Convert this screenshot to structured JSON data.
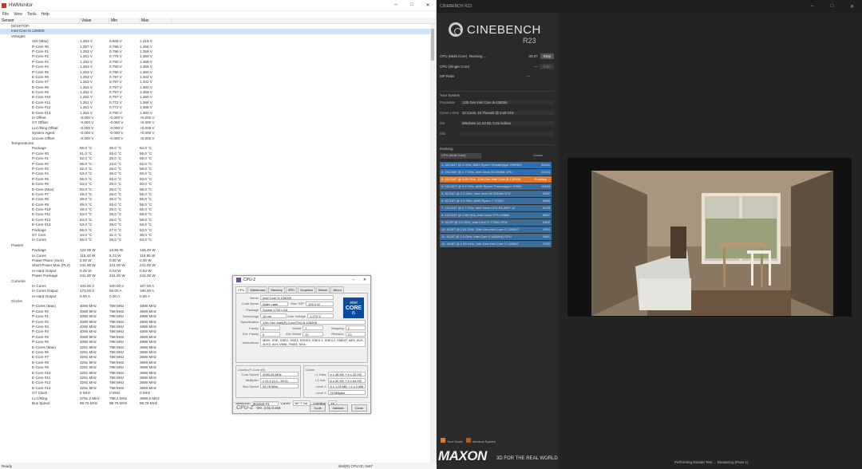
{
  "hwmonitor": {
    "title": "HWMonitor",
    "controls": [
      "–",
      "□",
      "✕"
    ],
    "menu": [
      "File",
      "View",
      "Tools",
      "Help"
    ],
    "columns": [
      "Sensor",
      "Value",
      "Min",
      "Max"
    ],
    "status_left": "Ready",
    "status_right": "Intel(R) CPU ID: 0x97"
  },
  "cpuz": {
    "title": "CPU-Z",
    "tabs": [
      "CPU",
      "Mainboard",
      "Memory",
      "SPD",
      "Graphics",
      "Bench",
      "About"
    ],
    "name": "Intel Core i5 12600K",
    "codename": "Alder Lake",
    "max_tdp": "125.0 W",
    "package": "Socket 1700 LGA",
    "technology": "10 nm",
    "core_voltage": "1.270 V",
    "specification": "12th Gen Intel(R) Core(TM) i5-12600K",
    "family": "6",
    "model": "7",
    "stepping": "2",
    "ext_family": "6",
    "ext_model": "97",
    "revision": "C0",
    "instructions": "MMX, SSE, SSE2, SSE3, SSSE3, SSE4.1, SSE4.2, EM64T, AES, AVX, AVX2, AVX-VNNI, FMA3, SHA",
    "core_speed": "4090.28 MHz",
    "multiplier": "x 41.0 (4.0 - 53.0)",
    "bus_speed": "99.76 MHz",
    "l1_data": "6 x 48 KB + 4 x 32 KB",
    "l1_inst": "6 x 32 KB + 4 x 64 KB",
    "level2": "6 x 1.25 MB + 2 x 2 MB",
    "level3": "20 MBytes",
    "selection": "Socket #1",
    "cores": "6P + 4E",
    "threads": "16",
    "version": "Ver. 2.01.0.x64",
    "buttons": [
      "Tools",
      "Validate",
      "Close"
    ],
    "intel_brand": "intel",
    "intel_core": "CORE",
    "intel_tier": "i5",
    "clocks_label": "Clocks (P-Core #0)",
    "cache_label": "Cache"
  },
  "cinebench": {
    "title": "CINEBENCH R23",
    "brand": "CINEBENCH",
    "version": "R23",
    "controls": [
      "–",
      "□",
      "✕"
    ],
    "multi_label": "CPU (Multi Core)",
    "multi_status": "Running ...",
    "multi_time": "00:37",
    "stop": "Stop",
    "single_label": "CPU (Single Core)",
    "single_time": "---",
    "single_btn": "Start",
    "mp_label": "MP Ratio",
    "mp_val": "---",
    "system_header": "Your System",
    "processor_key": "Processor",
    "processor_val": "12th Gen Intel Core i5-12600K",
    "cores_key": "Cores x GHz",
    "cores_val": "10 Cores, 16 Threads @ 3.69 GHz",
    "os_key": "OS",
    "os_val": "Windows 10, 64 Bit, Core Edition",
    "info_key": "Info",
    "info_val": "",
    "ranking_header": "Ranking",
    "ranking_select": "CPU (Multi Core)",
    "ranking_details": "Details",
    "ranking": [
      {
        "label": "1. 32C/64T @ 3 GHz, AMD Ryzen Threadripper 2990WX",
        "score": "30054"
      },
      {
        "label": "2. 24C/48T @ 2.7 GHz, Intel Xeon W-3265M CPU",
        "score": "24243"
      },
      {
        "label": "3. 10C/16T @ 3.69 GHz, 12th Gen Intel Core i5-12600K",
        "score": "Running ..."
      },
      {
        "label": "4. 16C/32T @ 3.4 GHz, AMD Ryzen Threadripper 1950X",
        "score": "16315"
      },
      {
        "label": "5. 8C/16T @ 2.3 GHz, Intel Xeon W-3245M CPU",
        "score": "9087"
      },
      {
        "label": "6. 8C/16T @ 3.4 GHz, AMD Ryzen 7 1700X",
        "score": "8889"
      },
      {
        "label": "7. 12C/24T @ 2.7 GHz, Intel Xeon CPU E5-2697 v2",
        "score": "8378"
      },
      {
        "label": "8. 12C/24T @ 2.66 GHz, Intel Xeon CPU X5650",
        "score": "6867"
      },
      {
        "label": "9. 4C/8T @ 4.2 GHz, Intel Core i7-7700K CPU",
        "score": "6302"
      },
      {
        "label": "10. 4C/8T @ 2.81 GHz, 11th Gen Intel Core i7-1165G7",
        "score": "4904"
      },
      {
        "label": "11. 4C/8T @ 2.3 GHz, Intel Core i7-4850HQ CPU",
        "score": "3891"
      },
      {
        "label": "12. 4C/8T @ 1.69 GHz, 11th Gen Intel Core i7-1165G7",
        "score": "3769"
      }
    ],
    "legend_score": "Your Score",
    "legend_identical": "Identical System",
    "maxon": "MAXON",
    "tagline": "3D FOR THE REAL WORLD",
    "status": "Performing Render Test ... Rendering (Pass 1)"
  },
  "colors": {
    "accent_blue": "#2f6fb0",
    "running_orange": "#e07a28",
    "cinebench_bg": "#2a2a2a"
  }
}
